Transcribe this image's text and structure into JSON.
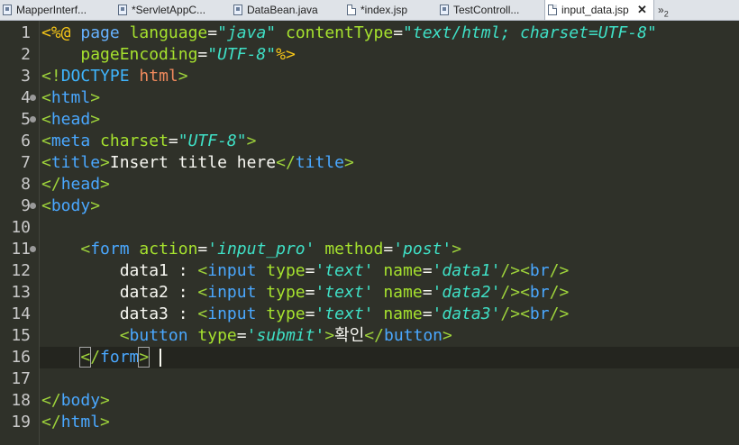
{
  "tabs": [
    {
      "label": "MapperInterf...",
      "icon": "java-file-icon",
      "active": false
    },
    {
      "label": "*ServletAppC...",
      "icon": "java-file-icon",
      "active": false
    },
    {
      "label": "DataBean.java",
      "icon": "java-file-icon",
      "active": false
    },
    {
      "label": "*index.jsp",
      "icon": "jsp-file-icon",
      "active": false
    },
    {
      "label": "TestControll...",
      "icon": "java-file-icon",
      "active": false
    },
    {
      "label": "input_data.jsp",
      "icon": "jsp-file-icon",
      "active": true
    }
  ],
  "tab_close": "✕",
  "tab_overflow": {
    "chevron": "»",
    "count": "2"
  },
  "line_numbers": [
    "1",
    "2",
    "3",
    "4",
    "5",
    "6",
    "7",
    "8",
    "9",
    "10",
    "11",
    "12",
    "13",
    "14",
    "15",
    "16",
    "17",
    "18",
    "19"
  ],
  "folds": [
    "4",
    "5",
    "9",
    "11"
  ],
  "current_line": "16",
  "code": {
    "l1": {
      "a": "<%@ ",
      "b": "page",
      "c": " ",
      "d": "language",
      "e": "=",
      "f": "\"java\"",
      "g": " ",
      "h": "contentType",
      "i": "=",
      "j": "\"text/html; charset=UTF-8\""
    },
    "l2": {
      "a": "    ",
      "b": "pageEncoding",
      "c": "=",
      "d": "\"UTF-8\"",
      "e": "%>"
    },
    "l3": {
      "a": "<!",
      "b": "DOCTYPE",
      "c": " ",
      "d": "html",
      "e": ">"
    },
    "l4": {
      "a": "<",
      "b": "html",
      "c": ">"
    },
    "l5": {
      "a": "<",
      "b": "head",
      "c": ">"
    },
    "l6": {
      "a": "<",
      "b": "meta",
      "c": " ",
      "d": "charset",
      "e": "=",
      "f": "\"UTF-8\"",
      "g": ">"
    },
    "l7": {
      "a": "<",
      "b": "title",
      "c": ">",
      "d": "Insert title here",
      "e": "</",
      "f": "title",
      "g": ">"
    },
    "l8": {
      "a": "</",
      "b": "head",
      "c": ">"
    },
    "l9": {
      "a": "<",
      "b": "body",
      "c": ">"
    },
    "l11": {
      "a": "    <",
      "b": "form",
      "c": " ",
      "d": "action",
      "e": "=",
      "f": "'input_pro'",
      "g": " ",
      "h": "method",
      "i": "=",
      "j": "'post'",
      "k": ">"
    },
    "l12": {
      "a": "        data1 : ",
      "b": "<",
      "c": "input",
      "d": " ",
      "e": "type",
      "f": "=",
      "g": "'text'",
      "h": " ",
      "i": "name",
      "j": "=",
      "k": "'data1'",
      "l": "/><",
      "m": "br",
      "n": "/>"
    },
    "l13": {
      "a": "        data2 : ",
      "b": "<",
      "c": "input",
      "d": " ",
      "e": "type",
      "f": "=",
      "g": "'text'",
      "h": " ",
      "i": "name",
      "j": "=",
      "k": "'data2'",
      "l": "/><",
      "m": "br",
      "n": "/>"
    },
    "l14": {
      "a": "        data3 : ",
      "b": "<",
      "c": "input",
      "d": " ",
      "e": "type",
      "f": "=",
      "g": "'text'",
      "h": " ",
      "i": "name",
      "j": "=",
      "k": "'data3'",
      "l": "/><",
      "m": "br",
      "n": "/>"
    },
    "l15": {
      "a": "        <",
      "b": "button",
      "c": " ",
      "d": "type",
      "e": "=",
      "f": "'submit'",
      "g": ">",
      "h": "확인",
      "i": "</",
      "j": "button",
      "k": ">"
    },
    "l16": {
      "a": "    ",
      "b": "<",
      "c": "/",
      "d": "form",
      "e": ">"
    },
    "l18": {
      "a": "</",
      "b": "body",
      "c": ">"
    },
    "l19": {
      "a": "</",
      "b": "html",
      "c": ">"
    }
  }
}
